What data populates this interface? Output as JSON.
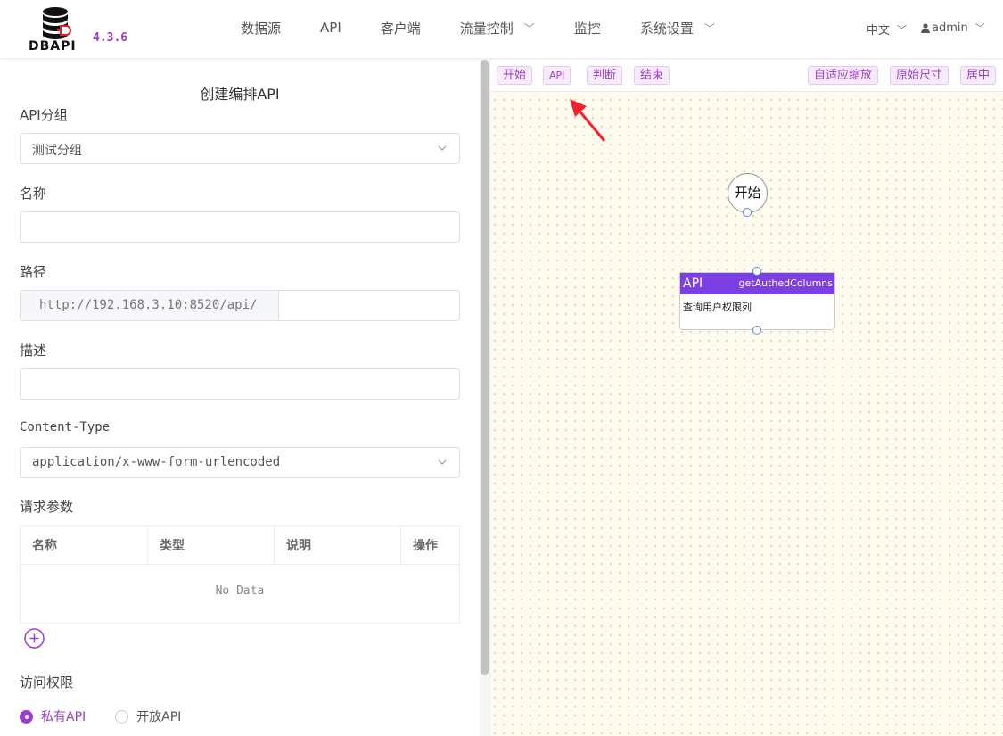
{
  "header": {
    "logo_text": "DBAPI",
    "version": "4.3.6",
    "nav": [
      {
        "label": "数据源",
        "dropdown": false
      },
      {
        "label": "API",
        "dropdown": false
      },
      {
        "label": "客户端",
        "dropdown": false
      },
      {
        "label": "流量控制",
        "dropdown": true
      },
      {
        "label": "监控",
        "dropdown": false
      },
      {
        "label": "系统设置",
        "dropdown": true
      }
    ],
    "language": "中文",
    "user": "admin"
  },
  "form": {
    "title": "创建编排API",
    "group_label": "API分组",
    "group_value": "测试分组",
    "name_label": "名称",
    "name_value": "",
    "path_label": "路径",
    "path_prefix": "http://192.168.3.10:8520/api/",
    "path_value": "",
    "desc_label": "描述",
    "desc_value": "",
    "content_type_label": "Content-Type",
    "content_type_value": "application/x-www-form-urlencoded",
    "params_label": "请求参数",
    "params_columns": [
      "名称",
      "类型",
      "说明",
      "操作"
    ],
    "params_empty": "No Data",
    "access_label": "访问权限",
    "access_options": [
      {
        "label": "私有API",
        "selected": true
      },
      {
        "label": "开放API",
        "selected": false
      }
    ]
  },
  "canvas": {
    "toolbar_left": [
      "开始",
      "API",
      "判断",
      "结束"
    ],
    "toolbar_right": [
      "自适应缩放",
      "原始尺寸",
      "居中"
    ],
    "start_node_label": "开始",
    "api_node": {
      "type": "API",
      "name": "getAuthedColumns",
      "description": "查询用户权限列"
    }
  },
  "colors": {
    "accent": "#9c3ec9",
    "api_node_header": "#7c3fe4",
    "canvas_bg": "#fffcef",
    "arrow": "#f5222d"
  }
}
